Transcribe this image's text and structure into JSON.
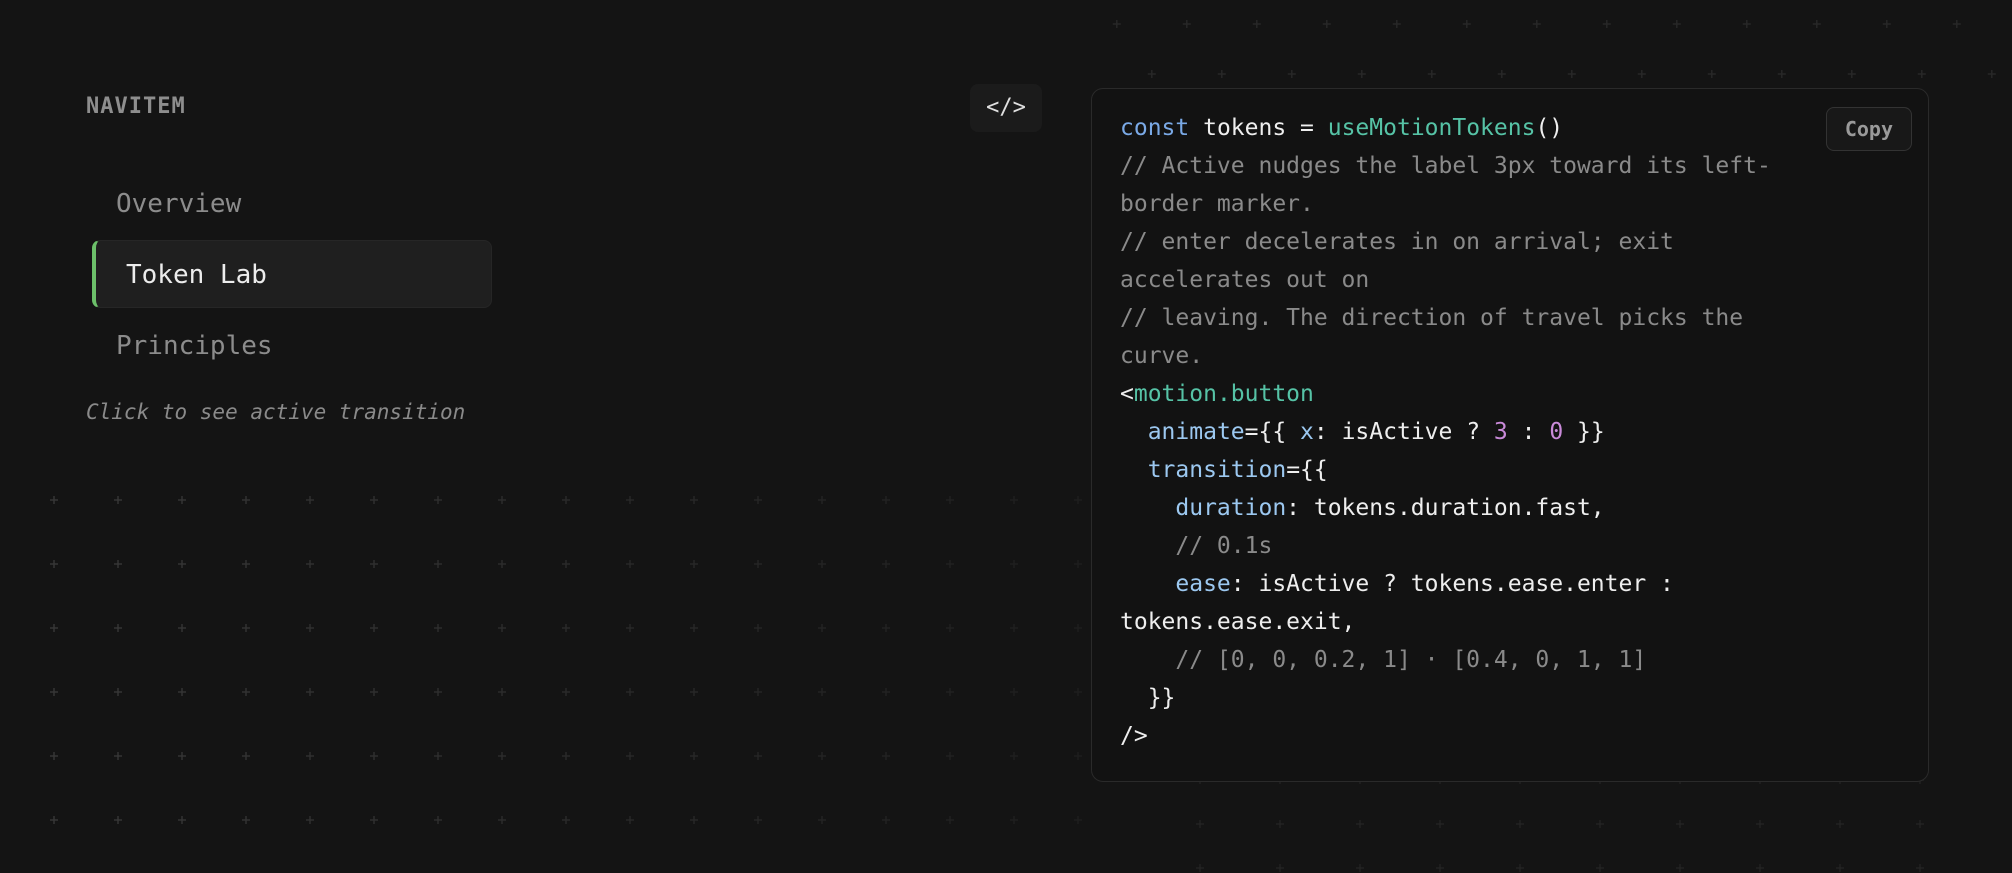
{
  "nav": {
    "title": "NAVITEM",
    "items": [
      {
        "label": "Overview",
        "active": false
      },
      {
        "label": "Token Lab",
        "active": true
      },
      {
        "label": "Principles",
        "active": false
      }
    ],
    "hint": "Click to see active transition",
    "accent_color": "#6cc06a"
  },
  "toolbar": {
    "code_toggle_label": "</>",
    "code_toggle_icon": "code-brackets-icon"
  },
  "code_panel": {
    "copy_label": "Copy",
    "lines": [
      {
        "indent": 0,
        "tokens": [
          {
            "t": "kw",
            "text": "const"
          },
          {
            "t": "pl",
            "text": " tokens = "
          },
          {
            "t": "fn",
            "text": "useMotionTokens"
          },
          {
            "t": "pl",
            "text": "()"
          }
        ]
      },
      {
        "indent": 0,
        "tokens": [
          {
            "t": "cm",
            "text": "// Active nudges the label 3px toward its left-"
          }
        ]
      },
      {
        "indent": 0,
        "tokens": [
          {
            "t": "cm",
            "text": "border marker."
          }
        ]
      },
      {
        "indent": 0,
        "tokens": [
          {
            "t": "cm",
            "text": "// enter decelerates in on arrival; exit"
          }
        ]
      },
      {
        "indent": 0,
        "tokens": [
          {
            "t": "cm",
            "text": "accelerates out on"
          }
        ]
      },
      {
        "indent": 0,
        "tokens": [
          {
            "t": "cm",
            "text": "// leaving. The direction of travel picks the"
          }
        ]
      },
      {
        "indent": 0,
        "tokens": [
          {
            "t": "cm",
            "text": "curve."
          }
        ]
      },
      {
        "indent": 0,
        "tokens": [
          {
            "t": "pl",
            "text": "<"
          },
          {
            "t": "fn",
            "text": "motion.button"
          }
        ]
      },
      {
        "indent": 2,
        "tokens": [
          {
            "t": "attr",
            "text": "animate"
          },
          {
            "t": "pl",
            "text": "={{ "
          },
          {
            "t": "attr",
            "text": "x"
          },
          {
            "t": "pl",
            "text": ": isActive ? "
          },
          {
            "t": "num",
            "text": "3"
          },
          {
            "t": "pl",
            "text": " : "
          },
          {
            "t": "num",
            "text": "0"
          },
          {
            "t": "pl",
            "text": " }}"
          }
        ]
      },
      {
        "indent": 2,
        "tokens": [
          {
            "t": "attr",
            "text": "transition"
          },
          {
            "t": "pl",
            "text": "={{"
          }
        ]
      },
      {
        "indent": 4,
        "tokens": [
          {
            "t": "attr",
            "text": "duration"
          },
          {
            "t": "pl",
            "text": ": tokens.duration.fast,"
          }
        ]
      },
      {
        "indent": 4,
        "tokens": [
          {
            "t": "cm",
            "text": "// 0.1s"
          }
        ]
      },
      {
        "indent": 4,
        "tokens": [
          {
            "t": "attr",
            "text": "ease"
          },
          {
            "t": "pl",
            "text": ": isActive ? tokens.ease.enter :"
          }
        ]
      },
      {
        "indent": 0,
        "tokens": [
          {
            "t": "pl",
            "text": "tokens.ease.exit,"
          }
        ]
      },
      {
        "indent": 4,
        "tokens": [
          {
            "t": "cm",
            "text": "// [0, 0, 0.2, 1] · [0.4, 0, 1, 1]"
          }
        ]
      },
      {
        "indent": 2,
        "tokens": [
          {
            "t": "pl",
            "text": "}}"
          }
        ]
      },
      {
        "indent": 0,
        "tokens": [
          {
            "t": "pl",
            "text": "/>"
          }
        ]
      }
    ]
  }
}
